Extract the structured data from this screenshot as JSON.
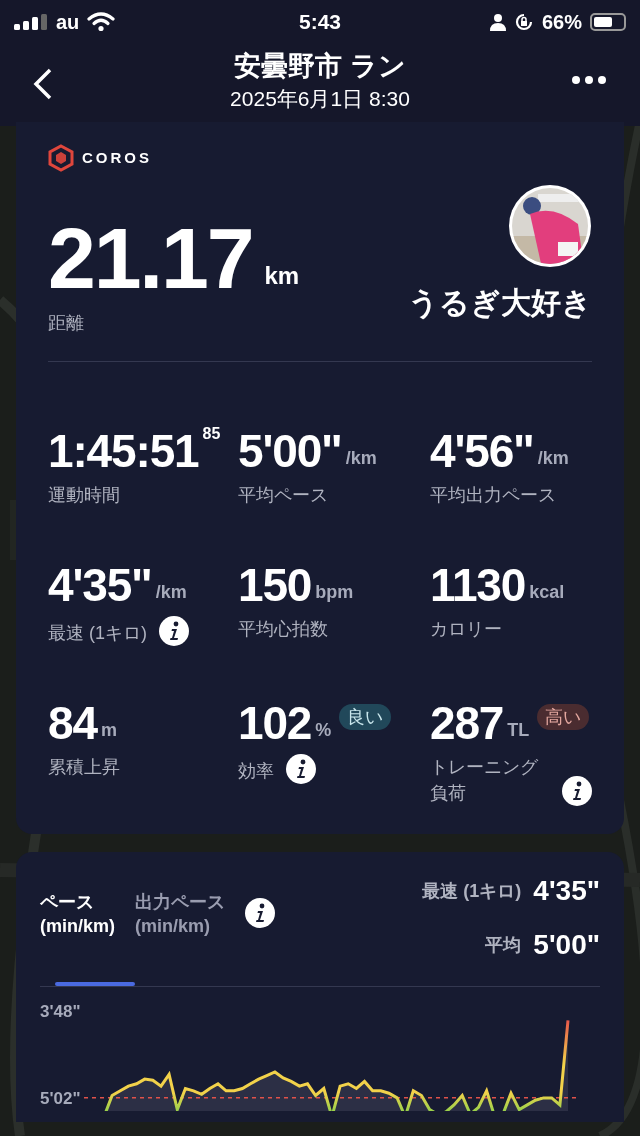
{
  "status_bar": {
    "carrier": "au",
    "time": "5:43",
    "battery": "66%"
  },
  "header": {
    "title": "安曇野市 ラン",
    "subtitle": "2025年6月1日 8:30"
  },
  "summary": {
    "brand": "COROS",
    "distance": "21.17",
    "unit": "km",
    "label": "距離",
    "user_name": "うるぎ大好き"
  },
  "stats": [
    {
      "value": "1:45:51",
      "sup": "85",
      "label": "運動時間",
      "info": false
    },
    {
      "value": "5'00\"",
      "unit": "/km",
      "label": "平均ペース",
      "info": false
    },
    {
      "value": "4'56\"",
      "unit": "/km",
      "label": "平均出力ペース",
      "info": false
    },
    {
      "value": "4'35\"",
      "unit": "/km",
      "label": "最速 (1キロ)",
      "info": true
    },
    {
      "value": "150",
      "unit": "bpm",
      "label": "平均心拍数",
      "info": false
    },
    {
      "value": "1130",
      "unit": "kcal",
      "label": "カロリー",
      "info": false
    },
    {
      "value": "84",
      "unit": "m",
      "label": "累積上昇",
      "info": false
    },
    {
      "value": "102",
      "unit": "%",
      "label": "効率",
      "info": true,
      "badge": {
        "text": "良い",
        "kind": "good"
      }
    },
    {
      "value": "287",
      "unit": "TL",
      "label": "トレーニング負荷",
      "info": true,
      "badge": {
        "text": "高い",
        "kind": "high"
      }
    }
  ],
  "pace_card": {
    "tabs": [
      {
        "label": "ペース",
        "unit": "(min/km)",
        "selected": true
      },
      {
        "label": "出力ペース",
        "unit": "(min/km)",
        "selected": false
      }
    ],
    "summary": [
      {
        "label": "最速 (1キロ)",
        "value": "4'35\""
      },
      {
        "label": "平均",
        "value": "5'00\""
      }
    ],
    "axis_labels": [
      "3'48\"",
      "5'02\""
    ]
  }
}
